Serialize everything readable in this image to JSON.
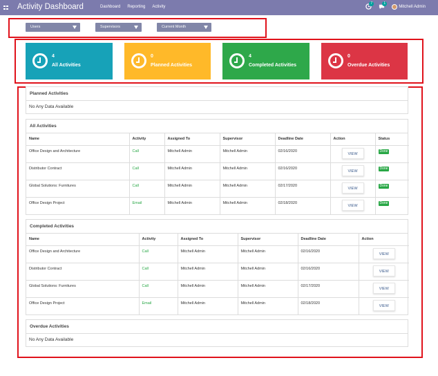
{
  "navbar": {
    "title": "Activity Dashboard",
    "menu": [
      "Dashboard",
      "Reporting",
      "Activity"
    ],
    "activity_badge": "7",
    "messages_badge": "1",
    "user_name": "Mitchell Admin"
  },
  "filters": {
    "users": "Users",
    "supervisors": "Supervisors",
    "period": "Current Month"
  },
  "cards": [
    {
      "count": "4",
      "label": "All Activities",
      "color": "#17a2b8"
    },
    {
      "count": "0",
      "label": "Planned Activities",
      "color": "#ffb929"
    },
    {
      "count": "4",
      "label": "Completed Activities",
      "color": "#2ea84a"
    },
    {
      "count": "0",
      "label": "Overdue Activities",
      "color": "#dc3545"
    }
  ],
  "planned": {
    "title": "Planned Activities",
    "empty_text": "No Any Data Available"
  },
  "all_activities": {
    "title": "All Activities",
    "headers": [
      "Name",
      "Activity",
      "Assigned To",
      "Supervisor",
      "Deadline Date",
      "Action",
      "Status"
    ],
    "view_label": "VIEW",
    "rows": [
      {
        "name": "Office Design and Architecture",
        "activity": "Call",
        "assigned": "Mitchell Admin",
        "supervisor": "Mitchell Admin",
        "deadline": "02/16/2020",
        "status": "Done"
      },
      {
        "name": "Distributor Contract",
        "activity": "Call",
        "assigned": "Mitchell Admin",
        "supervisor": "Mitchell Admin",
        "deadline": "02/16/2020",
        "status": "Done"
      },
      {
        "name": "Global Solutions: Furnitures",
        "activity": "Call",
        "assigned": "Mitchell Admin",
        "supervisor": "Mitchell Admin",
        "deadline": "02/17/2020",
        "status": "Done"
      },
      {
        "name": "Office Design Project",
        "activity": "Email",
        "assigned": "Mitchell Admin",
        "supervisor": "Mitchell Admin",
        "deadline": "02/18/2020",
        "status": "Done"
      }
    ]
  },
  "completed": {
    "title": "Completed Activities",
    "headers": [
      "Name",
      "Activity",
      "Assigned To",
      "Supervisor",
      "Deadline Date",
      "Action"
    ],
    "view_label": "VIEW",
    "rows": [
      {
        "name": "Office Design and Architecture",
        "activity": "Call",
        "assigned": "Mitchell Admin",
        "supervisor": "Mitchell Admin",
        "deadline": "02/16/2020"
      },
      {
        "name": "Distributor Contract",
        "activity": "Call",
        "assigned": "Mitchell Admin",
        "supervisor": "Mitchell Admin",
        "deadline": "02/16/2020"
      },
      {
        "name": "Global Solutions: Furnitures",
        "activity": "Call",
        "assigned": "Mitchell Admin",
        "supervisor": "Mitchell Admin",
        "deadline": "02/17/2020"
      },
      {
        "name": "Office Design Project",
        "activity": "Email",
        "assigned": "Mitchell Admin",
        "supervisor": "Mitchell Admin",
        "deadline": "02/18/2020"
      }
    ]
  },
  "overdue": {
    "title": "Overdue Activities",
    "empty_text": "No Any Data Available"
  }
}
